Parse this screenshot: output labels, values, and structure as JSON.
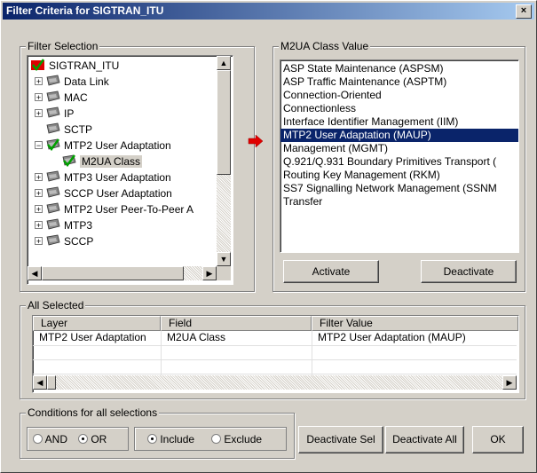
{
  "window": {
    "title": "Filter Criteria for SIGTRAN_ITU",
    "close_label": "×"
  },
  "filter_selection": {
    "legend": "Filter Selection",
    "tree": [
      {
        "label": "SIGTRAN_ITU",
        "expander": "",
        "checked": true
      },
      {
        "label": "Data Link",
        "expander": "+"
      },
      {
        "label": "MAC",
        "expander": "+"
      },
      {
        "label": "IP",
        "expander": "+"
      },
      {
        "label": "SCTP",
        "expander": ""
      },
      {
        "label": "MTP2 User Adaptation",
        "expander": "−",
        "checked": true
      },
      {
        "label": "M2UA Class",
        "expander": "",
        "checked": true,
        "selected": true
      },
      {
        "label": "MTP3 User Adaptation",
        "expander": "+"
      },
      {
        "label": "SCCP User Adaptation",
        "expander": "+"
      },
      {
        "label": "MTP2 User Peer-To-Peer A",
        "expander": "+"
      },
      {
        "label": "MTP3",
        "expander": "+"
      },
      {
        "label": "SCCP",
        "expander": "+"
      }
    ]
  },
  "class_value": {
    "legend": "M2UA Class Value",
    "items": [
      "ASP State Maintenance (ASPSM)",
      "ASP Traffic Maintenance (ASPTM)",
      "Connection-Oriented",
      "Connectionless",
      "Interface Identifier Management (IIM)",
      "MTP2 User Adaptation (MAUP)",
      "Management (MGMT)",
      "Q.921/Q.931 Boundary Primitives Transport (",
      "Routing Key Management (RKM)",
      "SS7 Signalling Network Management (SSNM",
      "Transfer"
    ],
    "selected_index": 5,
    "activate_label": "Activate",
    "deactivate_label": "Deactivate"
  },
  "all_selected": {
    "legend": "All Selected",
    "headers": [
      "Layer",
      "Field",
      "Filter Value"
    ],
    "rows": [
      [
        "MTP2 User Adaptation",
        "M2UA Class",
        "MTP2 User Adaptation (MAUP)"
      ]
    ]
  },
  "conditions": {
    "legend": "Conditions for all selections",
    "and_label": "AND",
    "or_label": "OR",
    "include_label": "Include",
    "exclude_label": "Exclude",
    "logic_selected": "OR",
    "mode_selected": "Include"
  },
  "buttons": {
    "deactivate_sel": "Deactivate Sel",
    "deactivate_all": "Deactivate All",
    "ok": "OK"
  },
  "colors": {
    "selection": "#0a246a",
    "check": "#00a000",
    "arrow": "#e00000"
  }
}
